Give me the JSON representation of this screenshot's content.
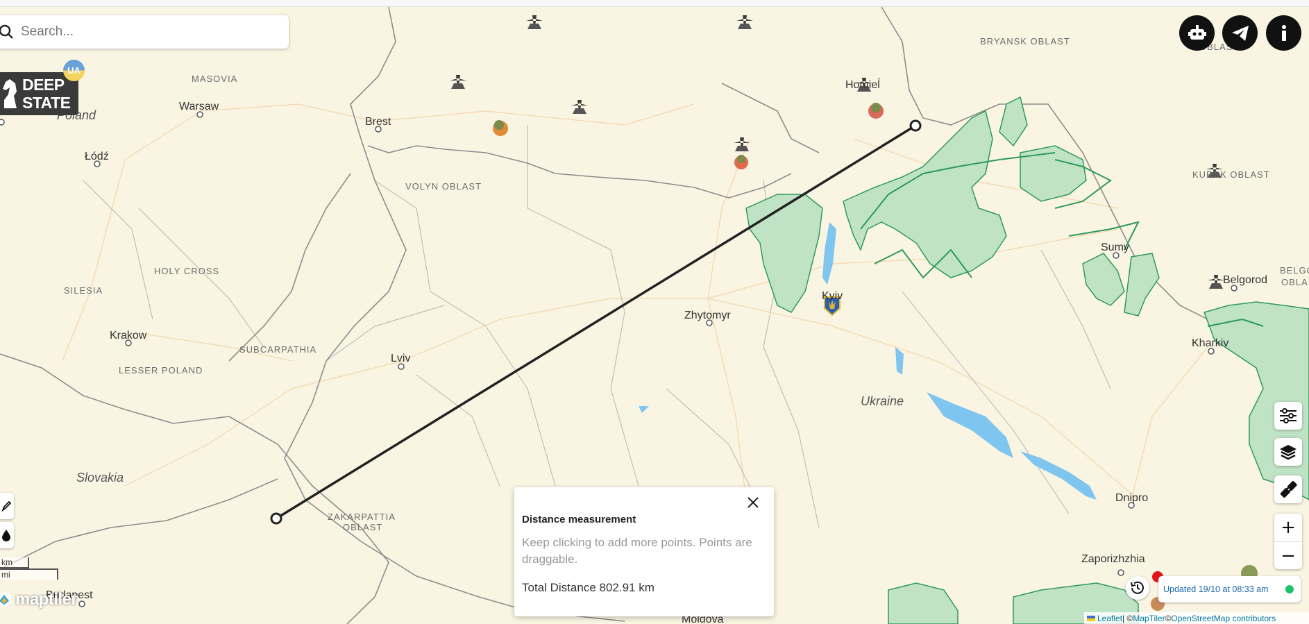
{
  "search": {
    "placeholder": "Search..."
  },
  "logo": {
    "line1": "DEEP",
    "line2": "STATE",
    "badge": "UA"
  },
  "top_buttons": [
    {
      "name": "robot-button",
      "icon": "robot-icon"
    },
    {
      "name": "telegram-button",
      "icon": "telegram-icon"
    },
    {
      "name": "info-button",
      "icon": "info-icon"
    }
  ],
  "right_controls": {
    "filters_icon": "sliders-icon",
    "layers_icon": "layers-icon",
    "ruler_icon": "ruler-icon",
    "zoom_in": "+",
    "zoom_out": "−"
  },
  "left_tools": {
    "draw_icon": "pen-icon",
    "drop_icon": "drop-icon"
  },
  "map": {
    "cities": [
      {
        "name": "Warsaw"
      },
      {
        "name": "Łódź"
      },
      {
        "name": "Krakow"
      },
      {
        "name": "Brest"
      },
      {
        "name": "Lviv"
      },
      {
        "name": "Zhytomyr"
      },
      {
        "name": "Kyiv"
      },
      {
        "name": "Homieĺ"
      },
      {
        "name": "Sumy"
      },
      {
        "name": "Belgorod"
      },
      {
        "name": "Kharkiv"
      },
      {
        "name": "Dnipro"
      },
      {
        "name": "Zaporizhzhia"
      },
      {
        "name": "Budapest"
      },
      {
        "name": "Moldova"
      }
    ],
    "regions": [
      "MASOVIA",
      "HOLY CROSS",
      "SILESIA",
      "SUBCARPATHIA",
      "LESSER POLAND",
      "VOLYN OBLAST",
      "ZAKARPATTIA",
      "OBLAST",
      "BRYANSK OBLAST",
      "KURSK OBLAST",
      "OBLAST",
      "BELGOR",
      "OBLA"
    ],
    "countries": [
      "Poland",
      "Slovakia",
      "Ukraine"
    ]
  },
  "measurement_popup": {
    "title": "Distance measurement",
    "hint": "Keep clicking to add more points. Points are draggable.",
    "total": "Total Distance 802.91 km"
  },
  "status": {
    "updated": "Updated 19/10 at 08:33 am"
  },
  "scale": {
    "km": "km",
    "mi": "mi"
  },
  "branding": {
    "maptiler": "maptiler"
  },
  "attribution": {
    "leaflet": "Leaflet",
    "sep": " | © ",
    "maptiler": "MapTiler",
    "sep2": " © ",
    "osm": "OpenStreetMap contributors"
  },
  "colors": {
    "map_bg": "#faf4e2",
    "occupied": "#bfe3c4",
    "occupied_border": "#2e9a5a",
    "water": "#7ec6f0",
    "popup_hint": "#999999",
    "updated_text": "#1a66b0",
    "live_dot": "#1ec26a",
    "alert_dot": "#e0161b"
  }
}
